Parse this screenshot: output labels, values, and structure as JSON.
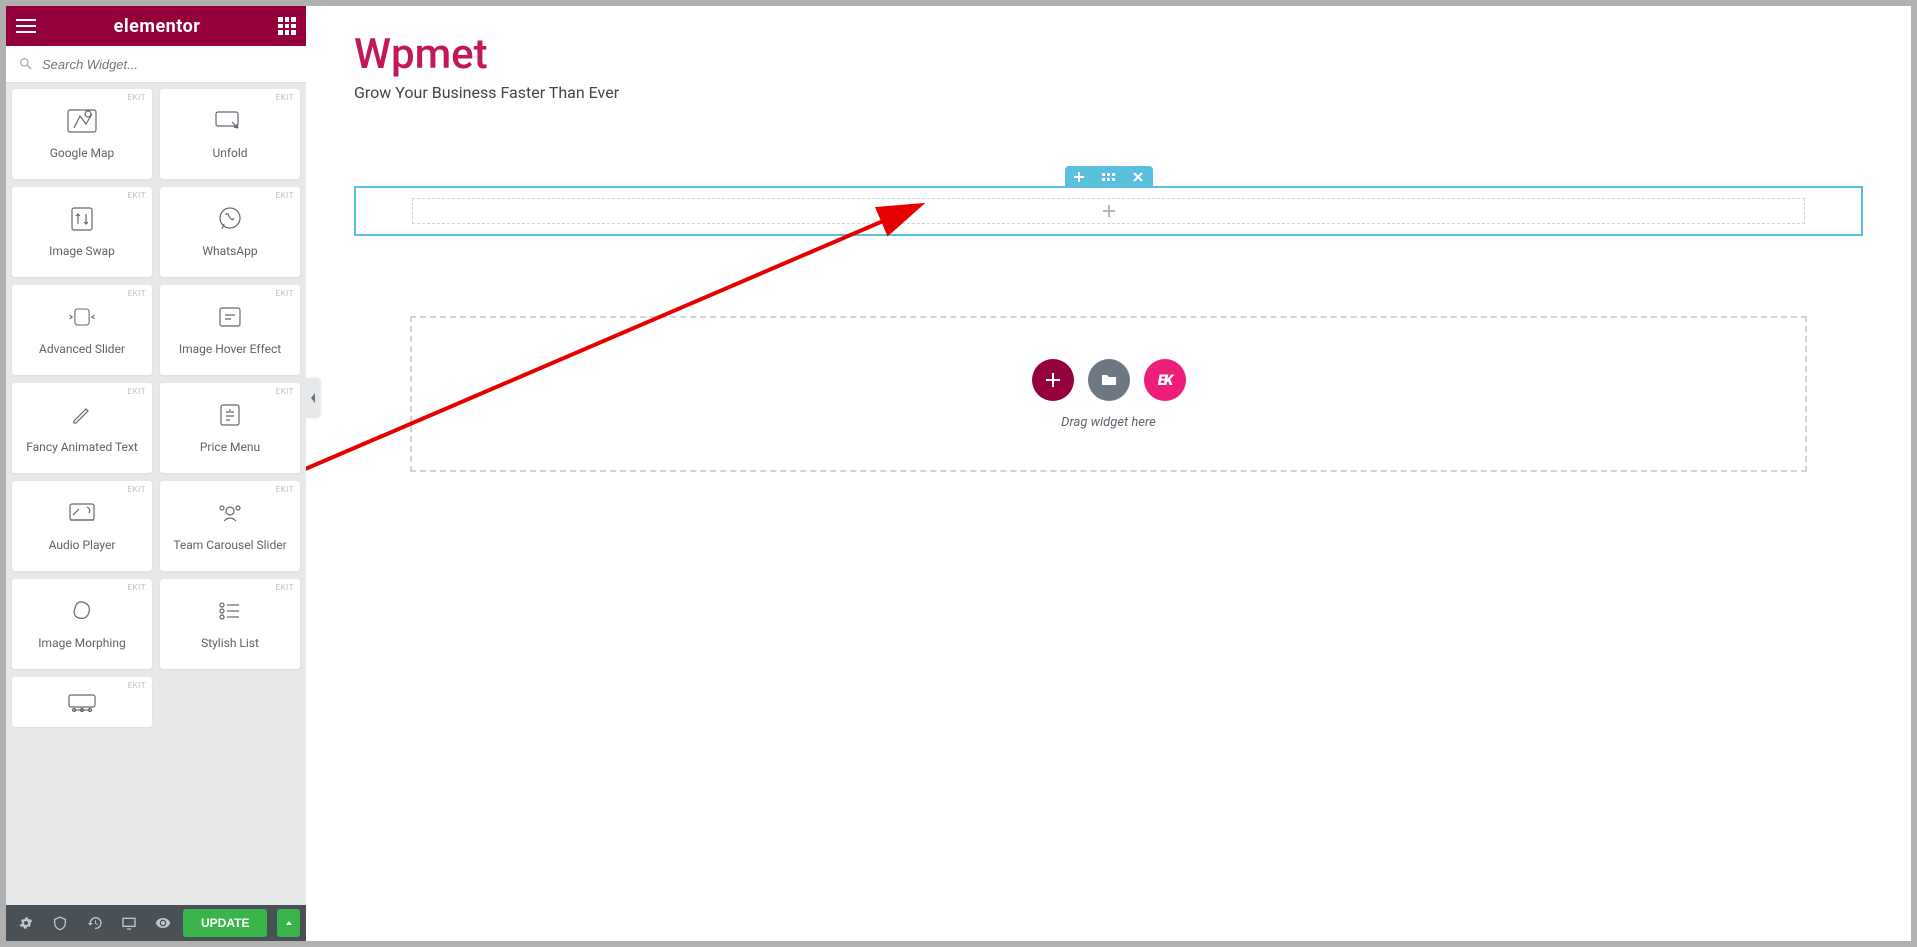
{
  "header": {
    "brand": "elementor"
  },
  "search": {
    "placeholder": "Search Widget..."
  },
  "widgets": [
    {
      "label": "Google Map",
      "tag": "EKIT",
      "icon": "map"
    },
    {
      "label": "Unfold",
      "tag": "EKIT",
      "icon": "unfold"
    },
    {
      "label": "Image Swap",
      "tag": "EKIT",
      "icon": "swap"
    },
    {
      "label": "WhatsApp",
      "tag": "EKIT",
      "icon": "whatsapp"
    },
    {
      "label": "Advanced Slider",
      "tag": "EKIT",
      "icon": "slider"
    },
    {
      "label": "Image Hover Effect",
      "tag": "EKIT",
      "icon": "hover"
    },
    {
      "label": "Fancy Animated Text",
      "tag": "EKIT",
      "icon": "pencil"
    },
    {
      "label": "Price Menu",
      "tag": "EKIT",
      "icon": "price"
    },
    {
      "label": "Audio Player",
      "tag": "EKIT",
      "icon": "audio"
    },
    {
      "label": "Team Carousel Slider",
      "tag": "EKIT",
      "icon": "team"
    },
    {
      "label": "Image Morphing",
      "tag": "EKIT",
      "icon": "morph"
    },
    {
      "label": "Stylish List",
      "tag": "EKIT",
      "icon": "list"
    },
    {
      "label": "",
      "tag": "EKIT",
      "icon": "breadcrumb"
    }
  ],
  "footer": {
    "update": "UPDATE"
  },
  "canvas": {
    "title": "Wpmet",
    "subtitle": "Grow Your Business Faster Than Ever",
    "drag_hint": "Drag widget here",
    "ek_label": "EK"
  }
}
